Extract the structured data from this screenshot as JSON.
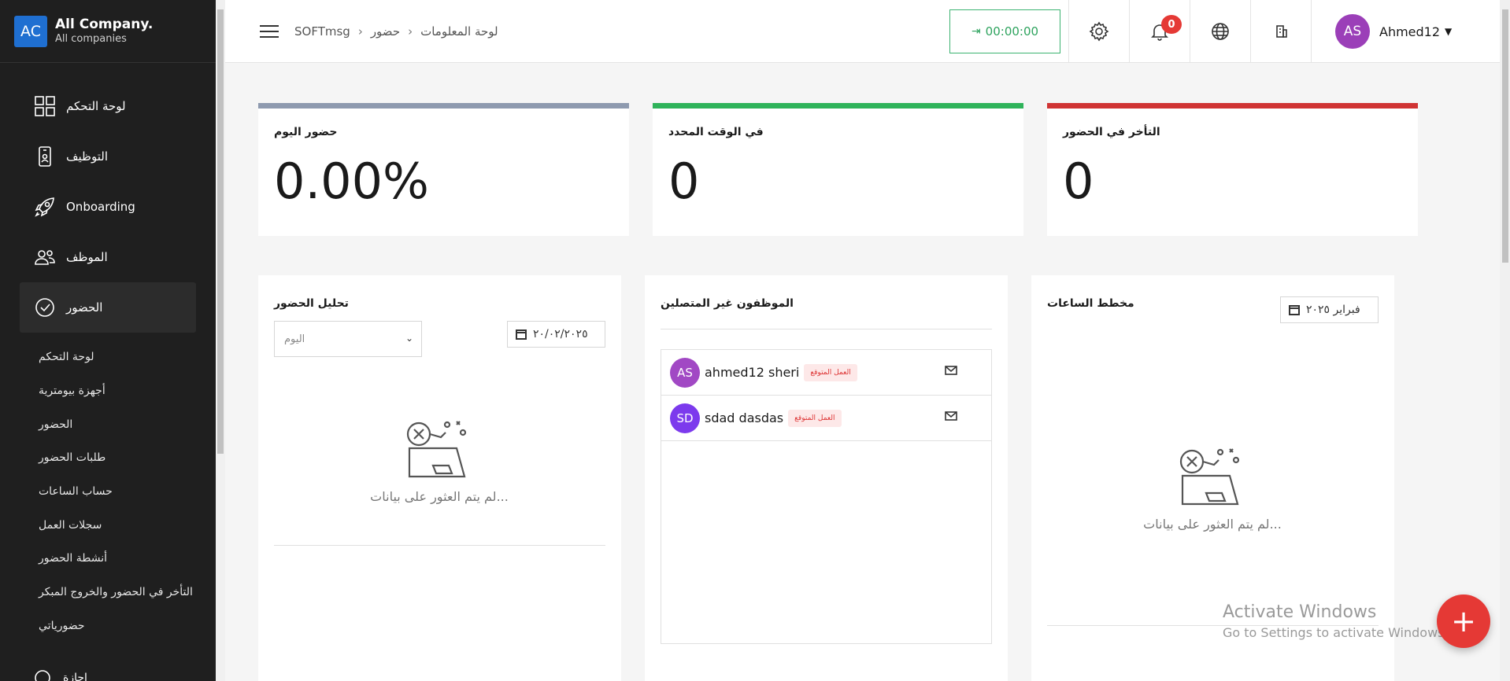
{
  "brand": {
    "logo_text": "AC",
    "name": "All Company.",
    "sub": "All companies"
  },
  "sidebar": {
    "items": [
      {
        "label": "لوحة التحكم",
        "icon": "grid-icon"
      },
      {
        "label": "التوظيف",
        "icon": "badge-icon"
      },
      {
        "label": "Onboarding",
        "icon": "rocket-icon"
      },
      {
        "label": "الموظف",
        "icon": "users-icon"
      },
      {
        "label": "الحضور",
        "icon": "check-circle-icon"
      }
    ],
    "sub_items": [
      "لوحة التحكم",
      "أجهزة بيومترية",
      "الحضور",
      "طلبات الحضور",
      "حساب الساعات",
      "سجلات العمل",
      "أنشطة الحضور",
      "التأخر في الحضور والخروج المبكر",
      "حضورياتي"
    ],
    "bottom_label": "إجازة"
  },
  "header": {
    "breadcrumb": [
      "SOFTmsg",
      "حضور",
      "لوحة المعلومات"
    ],
    "timer": "00:00:00",
    "notification_count": "0",
    "user_initials": "AS",
    "user_name": "Ahmed12"
  },
  "stats": [
    {
      "title": "حضور اليوم",
      "value": "0.00%",
      "color": "#8e9aaf"
    },
    {
      "title": "في الوقت المحدد",
      "value": "0",
      "color": "#2fb35a"
    },
    {
      "title": "التأخر في الحضور",
      "value": "0",
      "color": "#d03434"
    }
  ],
  "analysis": {
    "title": "تحليل الحضور",
    "select_value": "اليوم",
    "date": "٢٠/٠٢/٢٠٢٥",
    "empty_text": "لم يتم العثور على بيانات..."
  },
  "offline": {
    "title": "الموظفون غير المتصلين",
    "employees": [
      {
        "initials": "AS",
        "name": "ahmed12 sheri",
        "tag": "العمل المتوقع",
        "color": "#a148c4"
      },
      {
        "initials": "SD",
        "name": "sdad dasdas",
        "tag": "العمل المتوقع",
        "color": "#7c3aed"
      }
    ]
  },
  "hours": {
    "title": "مخطط الساعات",
    "month": "فبراير ٢٠٢٥",
    "empty_text": "لم يتم العثور على بيانات..."
  },
  "watermark": {
    "line1": "Activate Windows",
    "line2": "Go to Settings to activate Windows."
  },
  "fab_label": "+"
}
